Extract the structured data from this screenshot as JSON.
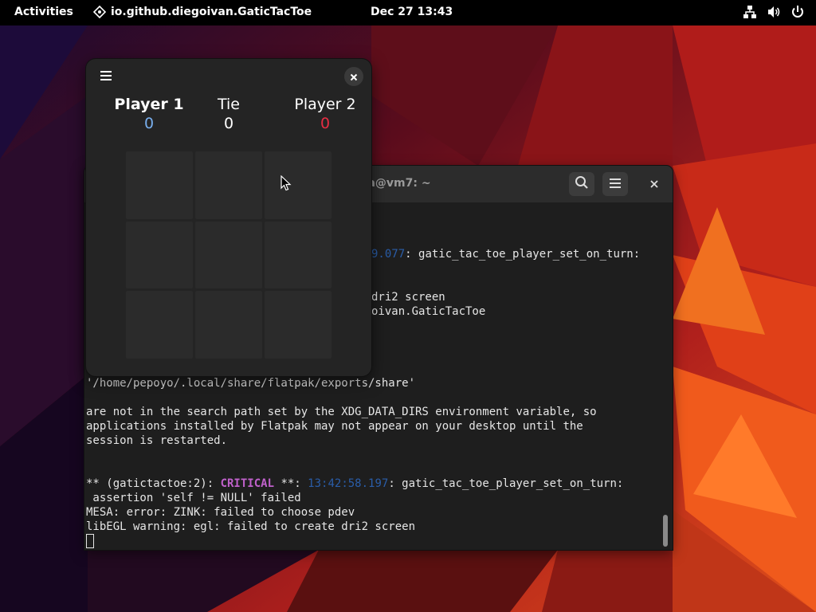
{
  "topbar": {
    "activities": "Activities",
    "app_name": "io.github.diegoivan.GaticTacToe",
    "clock": "Dec 27  13:43",
    "icons": [
      "network-icon",
      "volume-icon",
      "power-icon"
    ]
  },
  "terminal": {
    "title": "a@vm7: ~",
    "lines": [
      {
        "pre": "",
        "time": "9.077",
        "post": ": gatic_tac_toe_player_set_on_turn:"
      },
      {
        "pre": "dri2 screen",
        "time": "",
        "post": ""
      },
      {
        "pre": "oivan.GaticTacToe",
        "time": "",
        "post": ""
      },
      {
        "pre": "'/home/pepoyo/.local/share/flatpak/exports/share'",
        "time": "",
        "post": ""
      },
      {
        "pre": "are not in the search path set by the XDG_DATA_DIRS environment variable, so",
        "time": "",
        "post": ""
      },
      {
        "pre": "applications installed by Flatpak may not appear on your desktop until the",
        "time": "",
        "post": ""
      },
      {
        "pre": "session is restarted.",
        "time": "",
        "post": ""
      },
      {
        "pre": "** (gatictactoe:2): ",
        "crit": "CRITICAL",
        "mid": " **: ",
        "time": "13:42:58.197",
        "post": ": gatic_tac_toe_player_set_on_turn:"
      },
      {
        "pre": " assertion 'self != NULL' failed",
        "time": "",
        "post": ""
      },
      {
        "pre": "MESA: error: ZINK: failed to choose pdev",
        "time": "",
        "post": ""
      },
      {
        "pre": "libEGL warning: egl: failed to create dri2 screen",
        "time": "",
        "post": ""
      }
    ]
  },
  "game": {
    "player1_label": "Player 1",
    "player1_score": "0",
    "tie_label": "Tie",
    "tie_score": "0",
    "player2_label": "Player 2",
    "player2_score": "0",
    "colors": {
      "player1": "#78aeed",
      "player2": "#e62d42",
      "tie": "#ffffff"
    }
  }
}
